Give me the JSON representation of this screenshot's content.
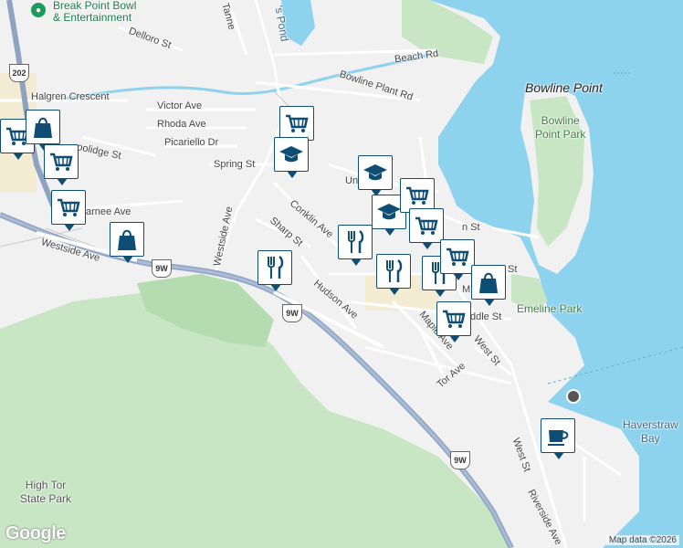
{
  "map": {
    "places": {
      "break_point": "Break Point Bowl\n& Entertainment",
      "bowline_point": "Bowline Point",
      "bowline_point_park": "Bowline\nPoint Park",
      "emeline_park": "Emeline Park",
      "haverstraw_bay": "Haverstraw\nBay",
      "high_tor": "High Tor\nState Park",
      "pond": "'s Pond"
    },
    "streets": {
      "delloro": "Delloro St",
      "tanne": "Tanne",
      "beach": "Beach Rd",
      "bowline_plant": "Bowline Plant Rd",
      "halgren": "Halgren Crescent",
      "victor": "Victor Ave",
      "rhoda": "Rhoda Ave",
      "picariello": "Picariello Dr",
      "spring": "Spring St",
      "coolidge": "oolidge St",
      "warnee": "arnee Ave",
      "westside_ave_vert": "Westside Ave",
      "westside_ave": "Westside Ave",
      "conklin": "Conklin Ave",
      "sharp": "Sharp St",
      "hudson": "Hudson Ave",
      "union": "Uni",
      "maple": "Maple Ave",
      "tor": "Tor Ave",
      "west_st": "West St",
      "west_st2": "West St",
      "middle": "ddle St",
      "riverside": "Riverside Ave",
      "n_st": "n St",
      "m_st": "M",
      "st_label": "St"
    },
    "shields": {
      "r202": "202",
      "r9w_a": "9W",
      "r9w_b": "9W",
      "r9w_c": "9W"
    },
    "attribution": "Map data ©2026",
    "logo": "Google"
  },
  "markers": [
    {
      "kind": "grocery",
      "name": "grocery-marker"
    },
    {
      "kind": "shopping",
      "name": "shopping-marker"
    },
    {
      "kind": "grocery",
      "name": "grocery-marker"
    },
    {
      "kind": "grocery",
      "name": "grocery-marker"
    },
    {
      "kind": "shopping",
      "name": "shopping-marker"
    },
    {
      "kind": "grocery",
      "name": "grocery-marker"
    },
    {
      "kind": "school",
      "name": "school-marker"
    },
    {
      "kind": "school",
      "name": "school-marker"
    },
    {
      "kind": "school",
      "name": "school-marker"
    },
    {
      "kind": "grocery",
      "name": "grocery-marker"
    },
    {
      "kind": "grocery",
      "name": "grocery-marker"
    },
    {
      "kind": "restaurant",
      "name": "restaurant-marker"
    },
    {
      "kind": "restaurant",
      "name": "restaurant-marker"
    },
    {
      "kind": "restaurant",
      "name": "restaurant-marker"
    },
    {
      "kind": "restaurant",
      "name": "restaurant-marker"
    },
    {
      "kind": "grocery",
      "name": "grocery-marker"
    },
    {
      "kind": "shopping",
      "name": "shopping-marker"
    },
    {
      "kind": "grocery",
      "name": "grocery-marker"
    },
    {
      "kind": "cafe",
      "name": "cafe-marker"
    }
  ]
}
